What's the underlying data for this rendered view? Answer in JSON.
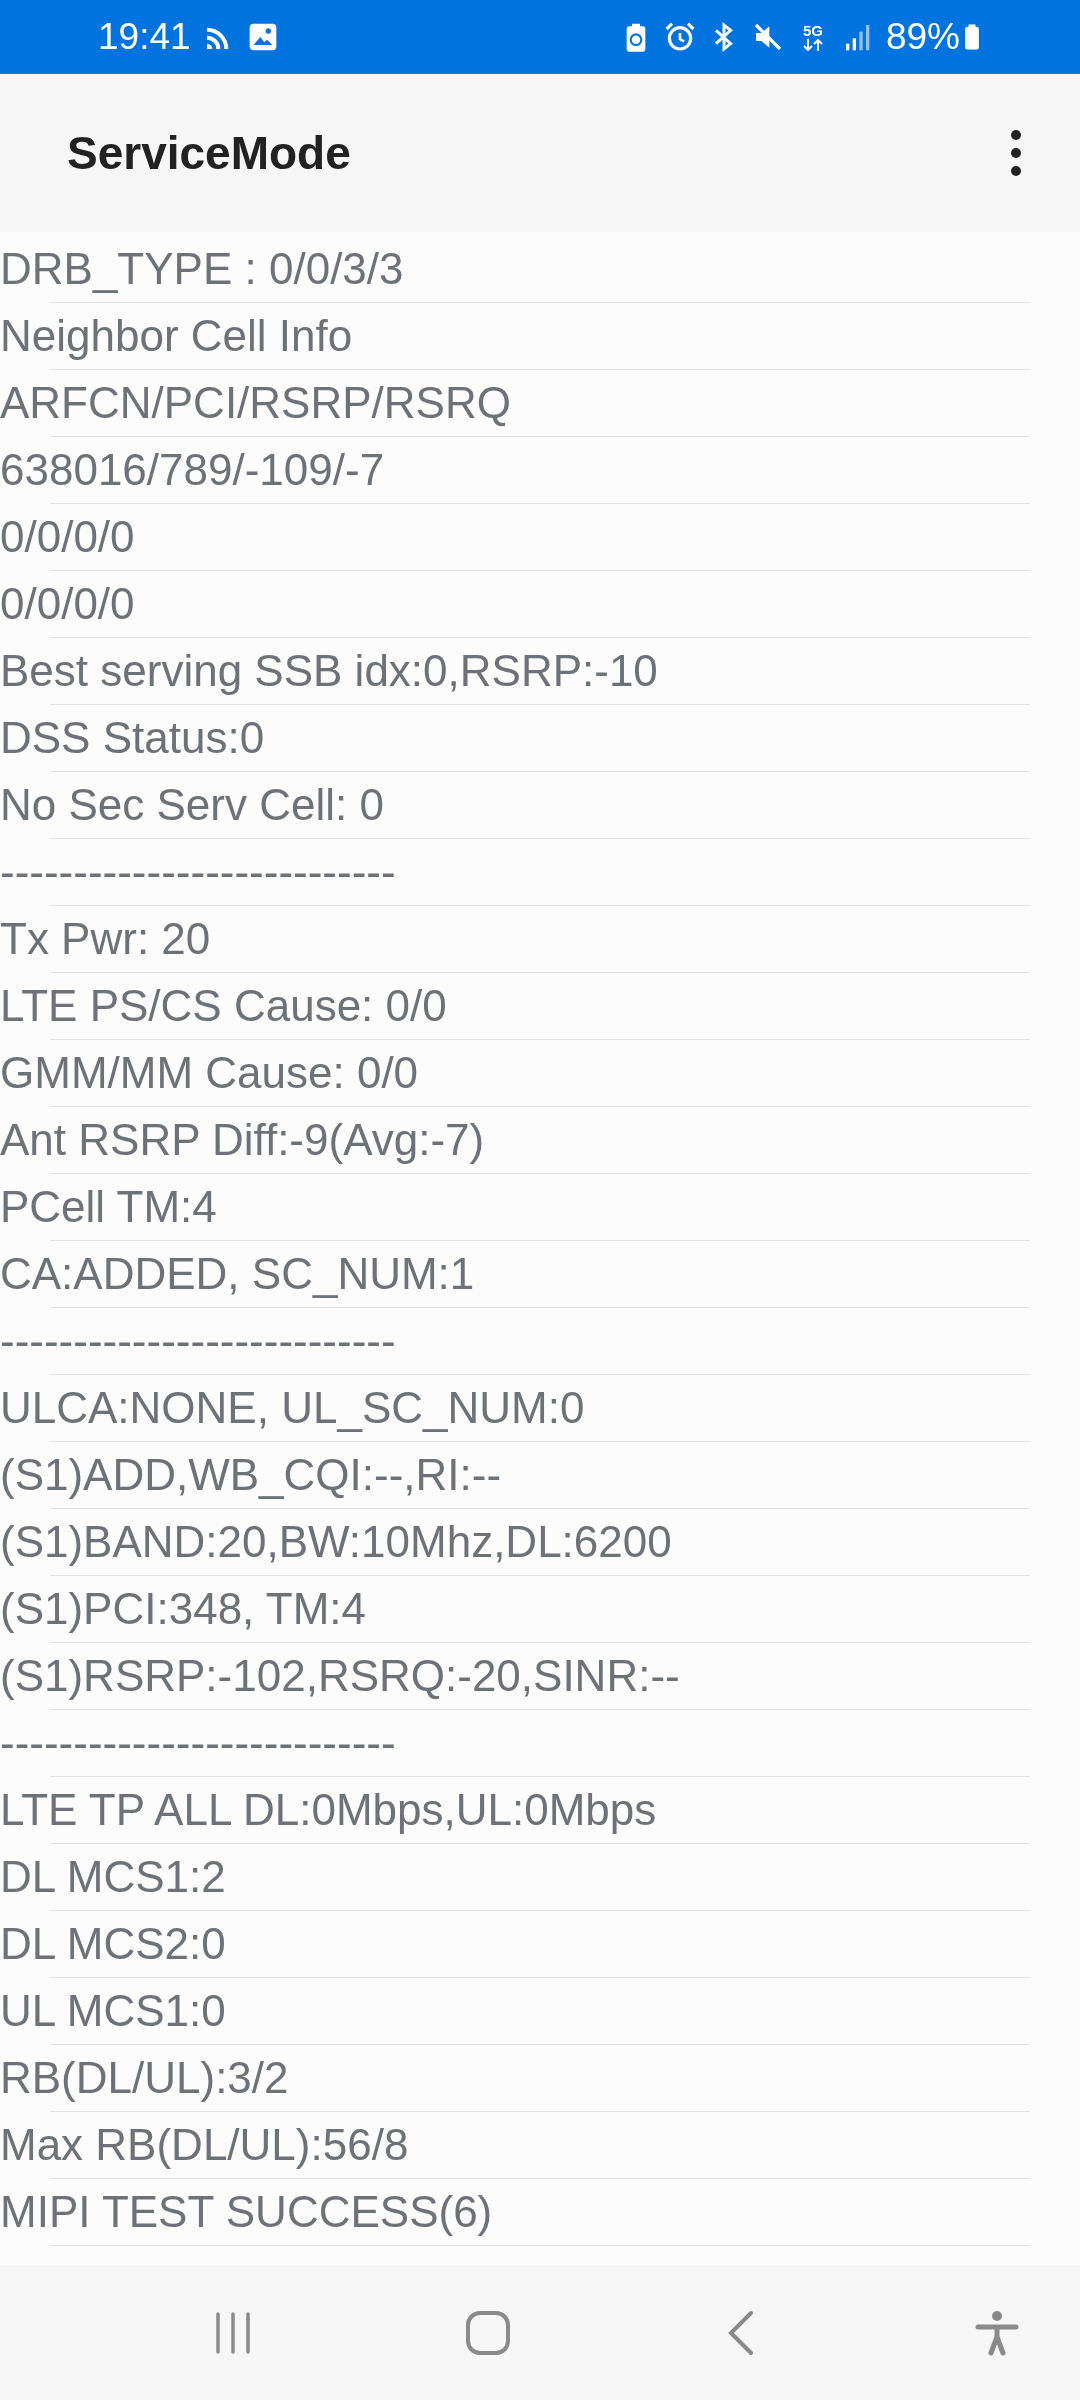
{
  "status_bar": {
    "time": "19:41",
    "network_label": "5G",
    "battery": "89%"
  },
  "app_bar": {
    "title": "ServiceMode"
  },
  "info_lines": [
    "DRB_TYPE : 0/0/3/3",
    "Neighbor Cell Info",
    "ARFCN/PCI/RSRP/RSRQ",
    "638016/789/-109/-7",
    "0/0/0/0",
    "0/0/0/0",
    "Best serving SSB idx:0,RSRP:-10",
    "DSS Status:0",
    "No Sec Serv Cell: 0",
    "---------------------------",
    "Tx Pwr: 20",
    "LTE PS/CS Cause: 0/0",
    "GMM/MM Cause: 0/0",
    "Ant RSRP Diff:-9(Avg:-7)",
    "PCell TM:4",
    "CA:ADDED, SC_NUM:1",
    "---------------------------",
    "ULCA:NONE, UL_SC_NUM:0",
    "(S1)ADD,WB_CQI:--,RI:--",
    "(S1)BAND:20,BW:10Mhz,DL:6200",
    "(S1)PCI:348, TM:4",
    "(S1)RSRP:-102,RSRQ:-20,SINR:--",
    "---------------------------",
    "LTE TP ALL DL:0Mbps,UL:0Mbps",
    "DL MCS1:2",
    "DL MCS2:0",
    "UL MCS1:0",
    "RB(DL/UL):3/2",
    "Max RB(DL/UL):56/8",
    "MIPI TEST SUCCESS(6)"
  ]
}
